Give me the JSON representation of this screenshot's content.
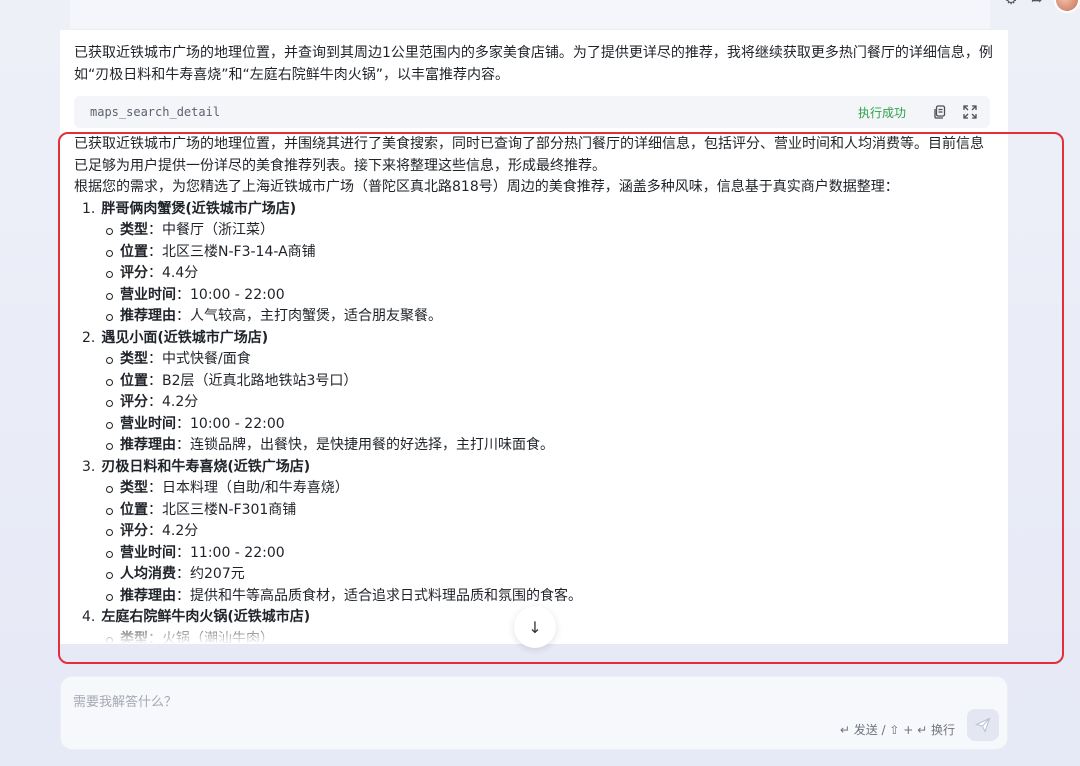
{
  "intro": {
    "text": "已获取近铁城市广场的地理位置，并查询到其周边1公里范围内的多家美食店铺。为了提供更详尽的推荐，我将继续获取更多热门餐厅的详细信息，例如“刃极日料和牛寿喜烧”和“左庭右院鲜牛肉火锅”，以丰富推荐内容。"
  },
  "tool_call": {
    "name": "maps_search_detail",
    "status": "执行成功",
    "copy_icon": "copy-icon",
    "expand_icon": "expand-icon"
  },
  "answer": {
    "para1": "已获取近铁城市广场的地理位置，并围绕其进行了美食搜索，同时已查询了部分热门餐厅的详细信息，包括评分、营业时间和人均消费等。目前信息已足够为用户提供一份详尽的美食推荐列表。接下来将整理这些信息，形成最终推荐。",
    "para2": "根据您的需求，为您精选了上海近铁城市广场（普陀区真北路818号）周边的美食推荐，涵盖多种风味，信息基于真实商户数据整理：",
    "restaurants": [
      {
        "num": "1.",
        "name": "胖哥俩肉蟹煲(近铁城市广场店)",
        "details": [
          {
            "k": "类型",
            "v": "：中餐厅（浙江菜）"
          },
          {
            "k": "位置",
            "v": "：北区三楼N-F3-14-A商铺"
          },
          {
            "k": "评分",
            "v": "：4.4分"
          },
          {
            "k": "营业时间",
            "v": "：10:00 - 22:00"
          },
          {
            "k": "推荐理由",
            "v": "：人气较高，主打肉蟹煲，适合朋友聚餐。"
          }
        ]
      },
      {
        "num": "2.",
        "name": "遇见小面(近铁城市广场店)",
        "details": [
          {
            "k": "类型",
            "v": "：中式快餐/面食"
          },
          {
            "k": "位置",
            "v": "：B2层（近真北路地铁站3号口）"
          },
          {
            "k": "评分",
            "v": "：4.2分"
          },
          {
            "k": "营业时间",
            "v": "：10:00 - 22:00"
          },
          {
            "k": "推荐理由",
            "v": "：连锁品牌，出餐快，是快捷用餐的好选择，主打川味面食。"
          }
        ]
      },
      {
        "num": "3.",
        "name": "刃极日料和牛寿喜烧(近铁广场店)",
        "details": [
          {
            "k": "类型",
            "v": "：日本料理（自助/和牛寿喜烧）"
          },
          {
            "k": "位置",
            "v": "：北区三楼N-F301商铺"
          },
          {
            "k": "评分",
            "v": "：4.2分"
          },
          {
            "k": "营业时间",
            "v": "：11:00 - 22:00"
          },
          {
            "k": "人均消费",
            "v": "：约207元"
          },
          {
            "k": "推荐理由",
            "v": "：提供和牛等高品质食材，适合追求日式料理品质和氛围的食客。"
          }
        ]
      },
      {
        "num": "4.",
        "name": "左庭右院鲜牛肉火锅(近铁城市店)",
        "details": [
          {
            "k": "类型",
            "v": "：火锅（潮汕牛肉）"
          }
        ]
      }
    ]
  },
  "scroll_button": {
    "icon": "arrow-down-icon",
    "glyph": "↓"
  },
  "composer": {
    "placeholder": "需要我解答什么？",
    "hint": "↵ 发送 / ⇧ + ↵ 换行",
    "send_icon": "send-icon"
  },
  "colors": {
    "highlight": "#e2303a",
    "success": "#2ca24a"
  }
}
